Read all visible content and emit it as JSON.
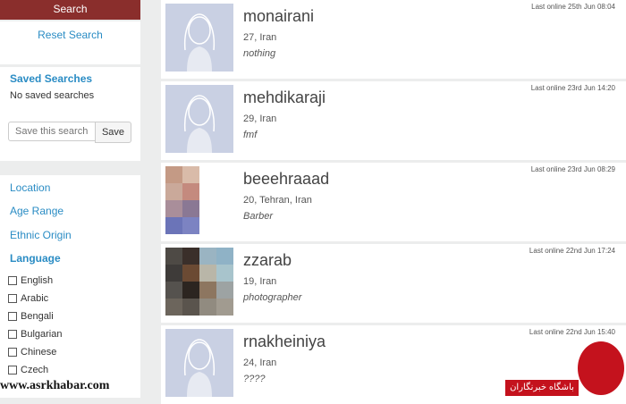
{
  "sidebar": {
    "search_label": "Search",
    "reset_label": "Reset Search",
    "saved_title": "Saved Searches",
    "saved_empty": "No saved searches",
    "save_placeholder": "Save this search",
    "save_label": "Save",
    "filters": [
      "Location",
      "Age Range",
      "Ethnic Origin",
      "Language"
    ],
    "languages": [
      "English",
      "Arabic",
      "Bengali",
      "Bulgarian",
      "Chinese",
      "Czech"
    ]
  },
  "profiles": [
    {
      "name": "monairani",
      "meta": "27, Iran",
      "tagline": "nothing",
      "online": "Last online 25th Jun 08:04",
      "photo": "placeholder"
    },
    {
      "name": "mehdikaraji",
      "meta": "29, Iran",
      "tagline": "fmf",
      "online": "Last online 23rd Jun 14:20",
      "photo": "placeholder"
    },
    {
      "name": "beeehraaad",
      "meta": "20, Tehran, Iran",
      "tagline": "Barber",
      "online": "Last online 23rd Jun 08:29",
      "photo": "pixelated"
    },
    {
      "name": "zzarab",
      "meta": "19, Iran",
      "tagline": "photographer",
      "online": "Last online 22nd Jun 17:24",
      "photo": "pixelated"
    },
    {
      "name": "rnakheiniya",
      "meta": "24, Iran",
      "tagline": "????",
      "online": "Last online 22nd Jun 15:40",
      "photo": "placeholder"
    }
  ],
  "watermark": "www.asrkhabar.com",
  "brand_text": "باشگاه خبرنگاران",
  "colors": {
    "accent": "#8a2e2c",
    "link": "#2a8cc4",
    "brand": "#c4121d"
  }
}
